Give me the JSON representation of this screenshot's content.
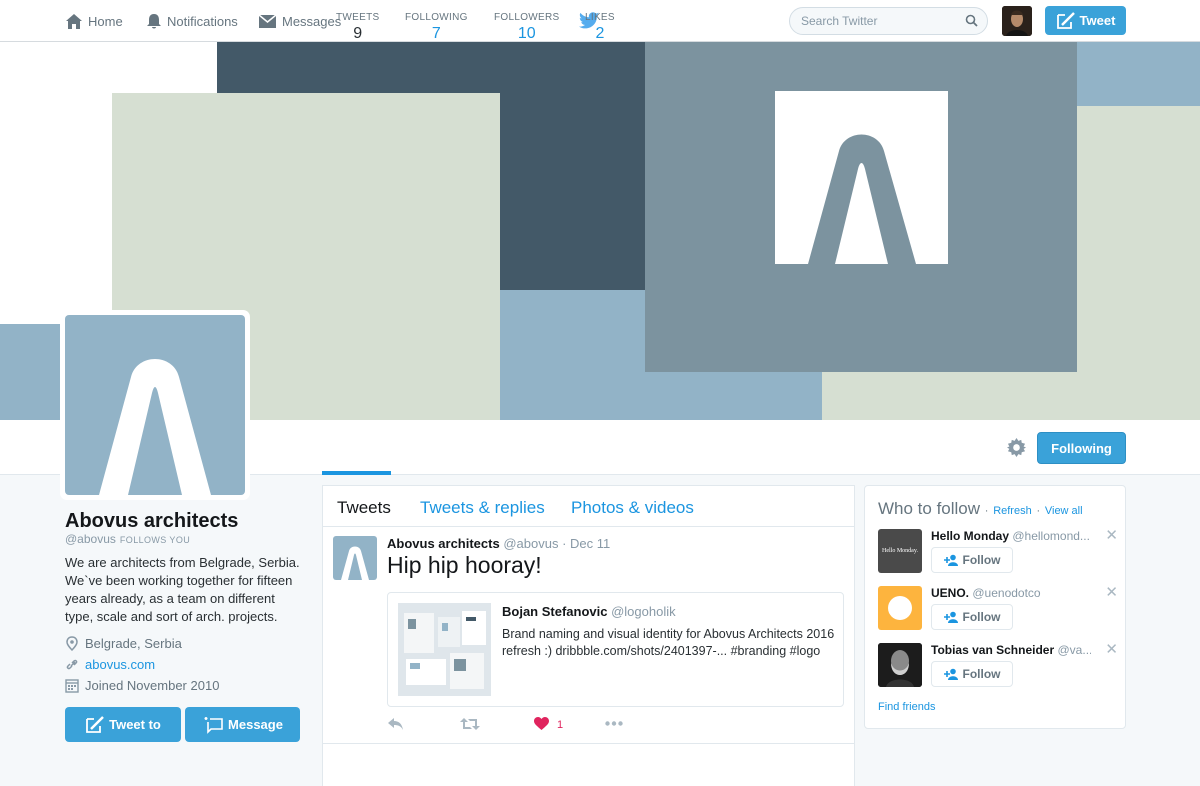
{
  "nav": {
    "home": "Home",
    "notifications": "Notifications",
    "messages": "Messages",
    "search_placeholder": "Search Twitter",
    "tweet_button": "Tweet"
  },
  "stats": [
    {
      "label": "TWEETS",
      "value": "9"
    },
    {
      "label": "FOLLOWING",
      "value": "7"
    },
    {
      "label": "FOLLOWERS",
      "value": "10"
    },
    {
      "label": "LIKES",
      "value": "2"
    }
  ],
  "following_button": "Following",
  "profile": {
    "name": "Abovus architects",
    "handle": "@abovus",
    "follows_you": "FOLLOWS YOU",
    "bio": "We are architects from Belgrade, Serbia. We`ve been working together for fifteen years already, as a team on different type, scale and sort of arch. projects.",
    "location": "Belgrade, Serbia",
    "website": "abovus.com",
    "joined": "Joined November 2010",
    "tweet_to": "Tweet to",
    "message": "Message"
  },
  "timeline": {
    "tabs": [
      "Tweets",
      "Tweets & replies",
      "Photos & videos"
    ],
    "tweet": {
      "name": "Abovus architects",
      "handle": "@abovus",
      "sep": "·",
      "date": "Dec 11",
      "text": "Hip hip hooray!",
      "card": {
        "name": "Bojan Stefanovic",
        "handle": "@logoholik",
        "text": "Brand naming and visual identity for Abovus Architects 2016 refresh :) dribbble.com/shots/2401397-... #branding #logo"
      },
      "likes": "1"
    }
  },
  "who_to_follow": {
    "title": "Who to follow",
    "sep": "·",
    "refresh": "Refresh",
    "view_all": "View all",
    "suggestions": [
      {
        "name": "Hello Monday",
        "handle": "@hellomond...",
        "follow": "Follow",
        "avatar_text": "Hello Monday."
      },
      {
        "name": "UENO.",
        "handle": "@uenodotco",
        "follow": "Follow"
      },
      {
        "name": "Tobias van Schneider",
        "handle": "@va...",
        "follow": "Follow"
      }
    ],
    "find_friends": "Find friends"
  },
  "colors": {
    "accent": "#1b95e0",
    "button": "#3aa2d9",
    "banner_light": "#d6dfd2",
    "banner_dark": "#435968",
    "banner_blue": "#92b3c7",
    "banner_slate": "#7c939f",
    "like": "#e0245e"
  }
}
